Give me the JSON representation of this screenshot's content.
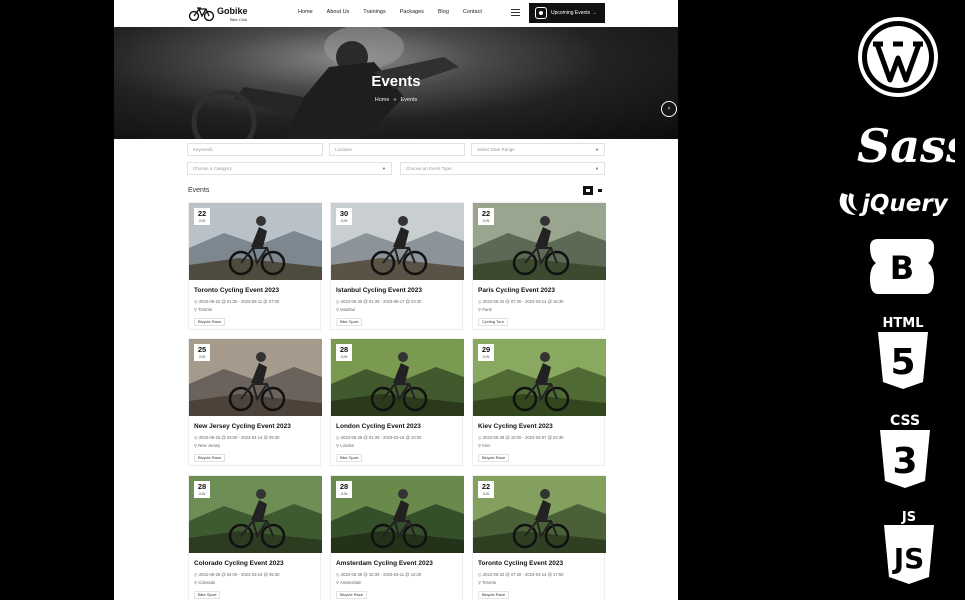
{
  "header": {
    "logo_name": "Gobike",
    "logo_tagline": "Bike Club",
    "nav": [
      "Home",
      "About Us",
      "Trainings",
      "Packages",
      "Blog",
      "Contact"
    ],
    "cta_label": "Upcoming Events →"
  },
  "hero": {
    "title": "Events",
    "breadcrumb_home": "Home",
    "breadcrumb_sep": "»",
    "breadcrumb_current": "Events",
    "scroll_top_glyph": "˄"
  },
  "filters": {
    "keywords": "Keywords",
    "location": "Location",
    "date_range": "Select Date Range",
    "category": "Choose a Category",
    "event_type": "Choose an Event Type"
  },
  "listing": {
    "label": "Events"
  },
  "events": [
    {
      "day": "22",
      "month": "JUN",
      "title": "Toronto Cycling Event 2023",
      "dates": "2022-06-22 @ 01:30 - 2023-08-11 @ 07:00",
      "location": "Toronto",
      "tag": "Bicycle Race"
    },
    {
      "day": "30",
      "month": "JUN",
      "title": "Istanbul Cycling Event 2023",
      "dates": "2022-06-30 @ 01:30 - 2023-08-17 @ 03:30",
      "location": "Istanbul",
      "tag": "Bike Sport"
    },
    {
      "day": "22",
      "month": "JUN",
      "title": "Paris Cycling Event 2023",
      "dates": "2022-06-22 @ 07:30 - 2023-04-14 @ 16:30",
      "location": "Paris",
      "tag": "Cycling Tour"
    },
    {
      "day": "25",
      "month": "JUN",
      "title": "New Jersey Cycling Event 2023",
      "dates": "2022-06-25 @ 03:00 - 2023-04-14 @ 05:30",
      "location": "New Jersey",
      "tag": "Bicycle Race"
    },
    {
      "day": "28",
      "month": "JUN",
      "title": "London Cycling Event 2023",
      "dates": "2022-06-28 @ 01:30 - 2023-03-16 @ 10:00",
      "location": "London",
      "tag": "Bike Sport"
    },
    {
      "day": "29",
      "month": "JUN",
      "title": "Kiev Cycling Event 2023",
      "dates": "2022-06-29 @ 10:00 - 2023-04-07 @ 04:30",
      "location": "Kiev",
      "tag": "Bicycle Race"
    },
    {
      "day": "28",
      "month": "JUN",
      "title": "Colorado Cycling Event 2023",
      "dates": "2022-06-28 @ 04:00 - 2023-03-24 @ 05:30",
      "location": "Colorado",
      "tag": "Bike Sport"
    },
    {
      "day": "28",
      "month": "JUN",
      "title": "Amsterdam Cycling Event 2023",
      "dates": "2022-06-28 @ 10:30 - 2023-03-11 @ 10:30",
      "location": "Amsterdam",
      "tag": "Bicycle Race"
    },
    {
      "day": "22",
      "month": "JUN",
      "title": "Toronto Cycling Event 2023",
      "dates": "2022-06-22 @ 07:30 - 2023-04-14 @ 17:50",
      "location": "Toronto",
      "tag": "Bicycle Race"
    }
  ],
  "tech_logos": {
    "wordpress": "wordpress-logo",
    "sass": "Sass",
    "jquery": "jQuery",
    "bootstrap": "B",
    "html5_label": "HTML",
    "html5_digit": "5",
    "css3_label": "CSS",
    "css3_digit": "3",
    "js_label": "JS",
    "js_mark": "JS"
  },
  "colors": {
    "page": "#000000",
    "card": "#ffffff",
    "accent": "#111111"
  }
}
